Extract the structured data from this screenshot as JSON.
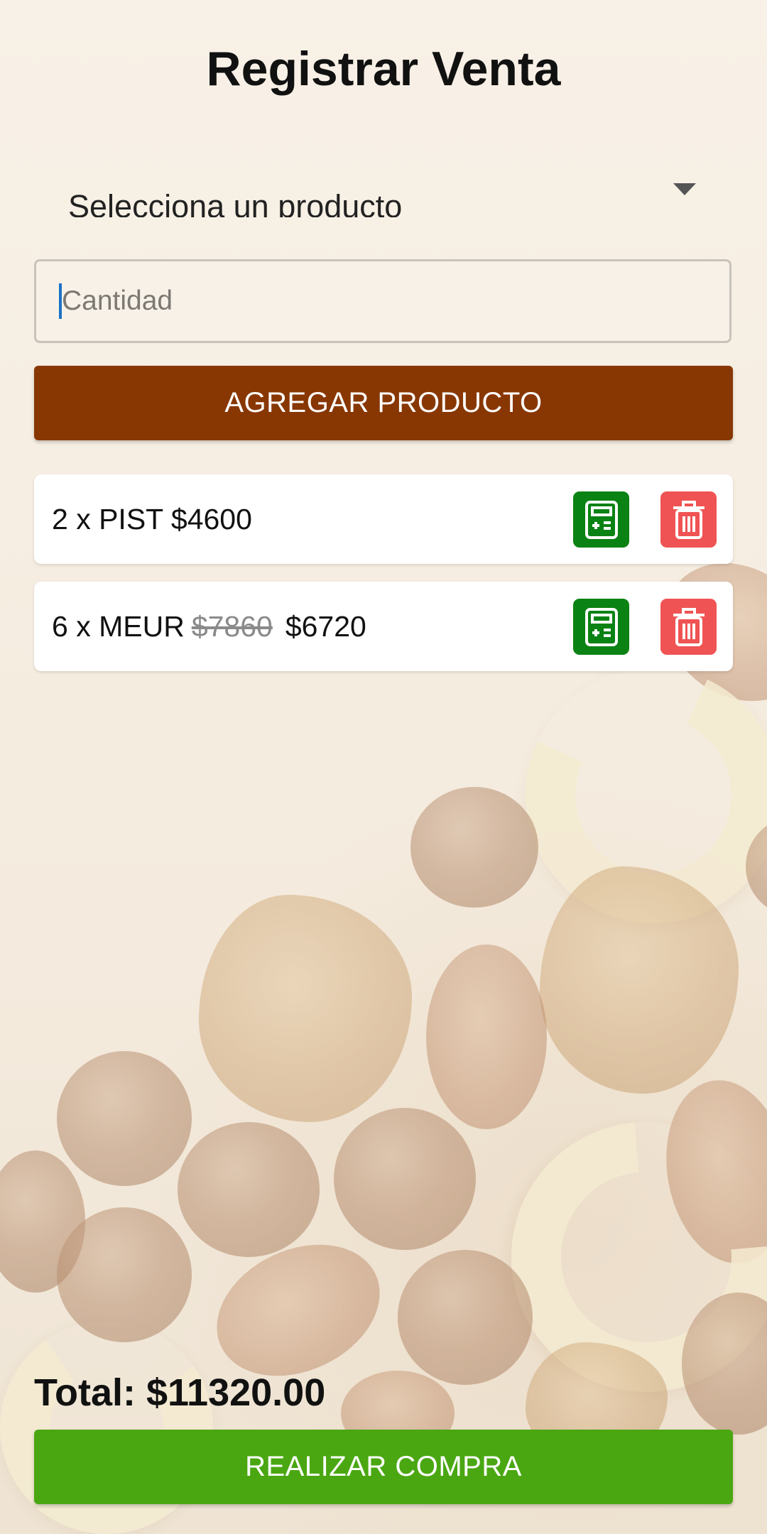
{
  "header": {
    "title": "Registrar Venta"
  },
  "form": {
    "product_select": {
      "selected_text": "Selecciona un producto"
    },
    "quantity": {
      "placeholder": "Cantidad"
    },
    "add_button_label": "AGREGAR PRODUCTO"
  },
  "cart": {
    "items": [
      {
        "label": "2 x PIST",
        "price": "$4600",
        "original_price": ""
      },
      {
        "label": "6 x MEUR",
        "price": "$6720",
        "original_price": "$7860"
      }
    ],
    "item_actions": [
      "calculator-icon",
      "trash-icon"
    ]
  },
  "summary": {
    "total_text": "Total: $11320.00",
    "buy_button_label": "REALIZAR COMPRA"
  },
  "colors": {
    "add_button": "#883702",
    "buy_button": "#4aa712",
    "calc_button": "#0b8214",
    "delete_button": "#f05353",
    "background": "#f6eee3"
  }
}
